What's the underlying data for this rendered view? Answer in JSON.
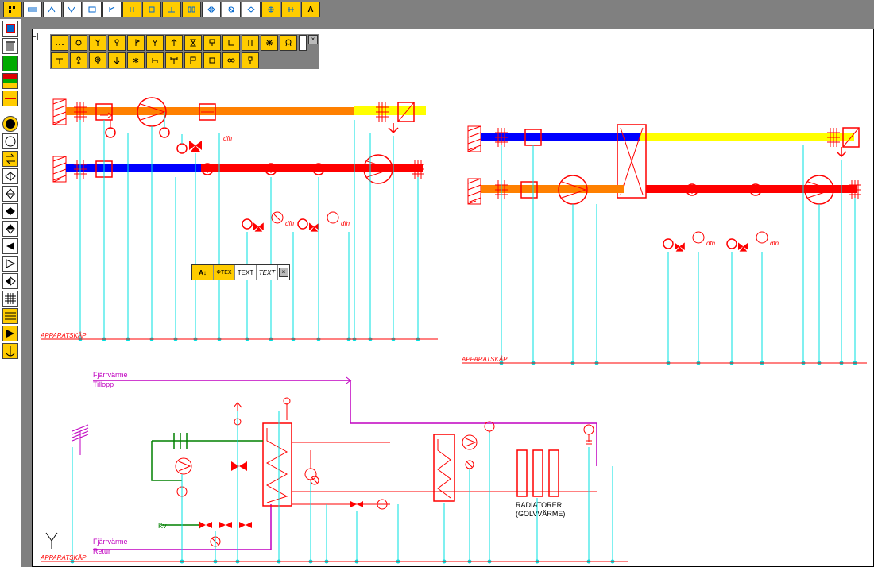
{
  "topToolbar": [
    "tool-1",
    "tool-2",
    "tool-3",
    "tool-4",
    "tool-5",
    "tool-6",
    "tool-7",
    "tool-8",
    "tool-9",
    "tool-10",
    "tool-11",
    "tool-12",
    "tool-13",
    "tool-14",
    "tool-15",
    "tool-16"
  ],
  "annotationTool": {
    "a_label": "A"
  },
  "leftPalette": [
    "brand",
    "trash",
    "layers-green",
    "layers-yellow",
    "line-yellow",
    "divider",
    "circle-yellow",
    "circle-empty",
    "swap",
    "valve1",
    "valve2",
    "valve3",
    "valve4",
    "valve5",
    "left-tri",
    "right-tri",
    "swap2",
    "hatch",
    "lines-yellow",
    "right-tri-y",
    "anchor"
  ],
  "symbolPalette": {
    "row1": [
      "sp1",
      "sp2",
      "sp3",
      "sp4",
      "sp5",
      "sp6",
      "sp7",
      "sp8",
      "sp9",
      "sp10",
      "sp11",
      "sp12",
      "sp13",
      "sp14"
    ],
    "row2": [
      "sp15",
      "sp16",
      "sp17",
      "sp18",
      "sp19",
      "sp20",
      "sp21",
      "sp22",
      "sp23",
      "sp24",
      "sp25"
    ]
  },
  "textToolbar": {
    "btn1": "A↓",
    "btn2": "ΦTEX",
    "btn3": "TEXT",
    "btn4": "TEXT"
  },
  "labels": {
    "apparatskap1": "APPARATSKÅP",
    "apparatskap2": "APPARATSKÅP",
    "apparatskap3": "APPARATSKÅP",
    "fjarrvarme": "Fjärrvärme",
    "tillopp": "Tillopp",
    "retur": "Retur",
    "kv": "Kv",
    "radiatorer": "RADIATORER",
    "golvvarme": "(GOLVVÄRME)",
    "dfn": "dfn"
  },
  "colors": {
    "orange": "#ff8000",
    "blue": "#0000ff",
    "red": "#ff0000",
    "yellow": "#ffff00",
    "cyan": "#00e0e0",
    "green": "#008000",
    "magenta": "#c000c0"
  }
}
